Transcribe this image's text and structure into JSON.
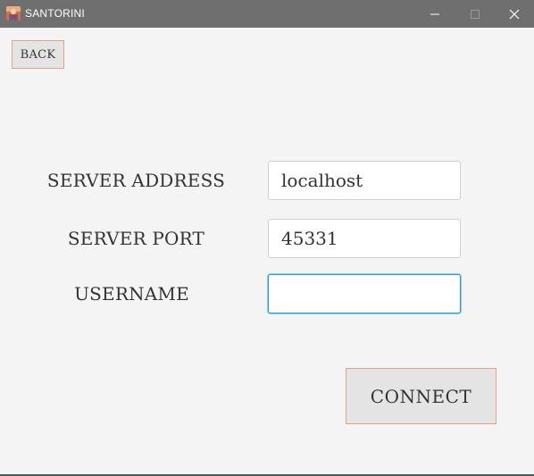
{
  "window": {
    "title": "SANTORINI",
    "icon": "santorini-app-icon"
  },
  "back_button": {
    "label": "BACK"
  },
  "form": {
    "server_address": {
      "label": "SERVER ADDRESS",
      "value": "localhost"
    },
    "server_port": {
      "label": "SERVER PORT",
      "value": "45331"
    },
    "username": {
      "label": "USERNAME",
      "value": ""
    }
  },
  "connect_button": {
    "label": "CONNECT"
  },
  "colors": {
    "titlebar": "#6f6f6f",
    "background": "#f4f4f4",
    "button_border": "#e8a088",
    "focus_border": "#2a9bd8"
  }
}
